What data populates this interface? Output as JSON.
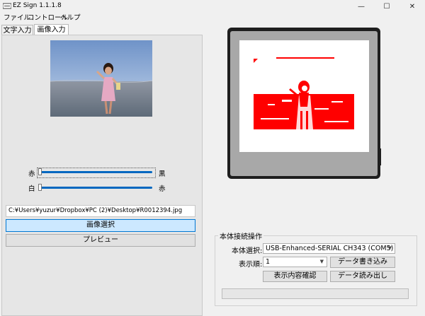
{
  "window": {
    "title": "EZ Sign 1.1.1.8",
    "controls": {
      "minimize": "—",
      "maximize": "☐",
      "close": "✕"
    }
  },
  "menu": [
    "ファイル",
    "コントロール",
    "ヘルプ"
  ],
  "tabs": [
    {
      "label": "文字入力",
      "active": false
    },
    {
      "label": "画像入力",
      "active": true
    }
  ],
  "image_panel": {
    "sliders": [
      {
        "left_label": "赤",
        "right_label": "黒",
        "value": 0
      },
      {
        "left_label": "白",
        "right_label": "赤",
        "value": 0
      }
    ],
    "file_path": "C:¥Users¥yuzur¥Dropbox¥PC (2)¥Desktop¥R0012394.jpg",
    "select_image_label": "画像選択",
    "preview_label": "プレビュー"
  },
  "device_group": {
    "title": "本体接続操作",
    "device_select_label": "本体選択:",
    "device_select_value": "USB-Enhanced-SERIAL CH343 (COM5)",
    "display_order_label": "表示順:",
    "display_order_value": "1",
    "write_label": "データ書き込み",
    "confirm_label": "表示内容確認",
    "read_label": "データ読み出し",
    "progress": 0
  },
  "colors": {
    "accent": "#0067c0",
    "primary_button_bg": "#cce8ff",
    "primary_button_border": "#0078d4",
    "preview_red": "#ff0000"
  }
}
